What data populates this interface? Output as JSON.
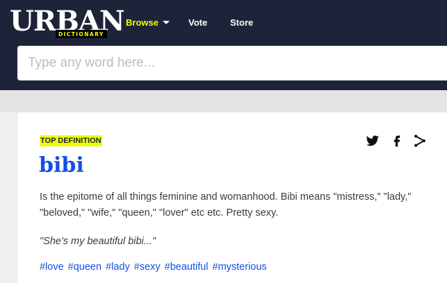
{
  "header": {
    "logo": {
      "word": "URBAN",
      "sub": "DICTIONARY"
    },
    "nav": {
      "browse": "Browse",
      "vote": "Vote",
      "store": "Store"
    },
    "search": {
      "placeholder": "Type any word here..."
    }
  },
  "definition": {
    "badge": "TOP DEFINITION",
    "word": "bibi",
    "meaning": "Is the epitome of all things feminine and womanhood. Bibi means \"mistress,\" \"lady,\" \"beloved,\" \"wife,\" \"queen,\" \"lover\" etc etc. Pretty sexy.",
    "example": "\"She's my beautiful bibi...\"",
    "tags": [
      "#love",
      "#queen",
      "#lady",
      "#sexy",
      "#beautiful",
      "#mysterious"
    ],
    "share_icons": [
      "twitter-icon",
      "facebook-icon",
      "share-icon"
    ]
  },
  "colors": {
    "header_bg": "#1d2439",
    "accent_yellow": "#efff00",
    "link_blue": "#134fe6"
  }
}
